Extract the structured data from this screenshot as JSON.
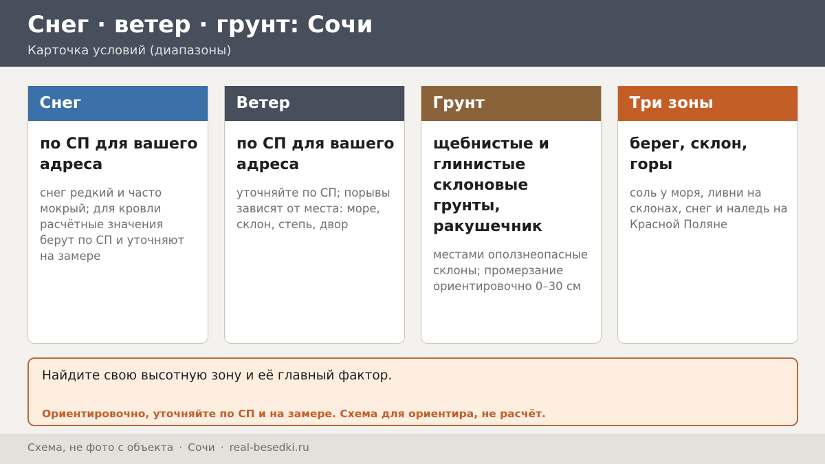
{
  "header": {
    "title": "Снег · ветер · грунт: Сочи",
    "subtitle": "Карточка условий (диапазоны)"
  },
  "cards": [
    {
      "label": "Снег",
      "color": "#3b71a8",
      "main": "по СП для вашего адреса",
      "note": "снег редкий и часто мокрый; для кровли расчётные значения берут по СП и уточняют на замере"
    },
    {
      "label": "Ветер",
      "color": "#464f5b",
      "main": "по СП для вашего адреса",
      "note": "уточняйте по СП; порывы зависят от места: море, склон, степь, двор"
    },
    {
      "label": "Грунт",
      "color": "#8b633b",
      "main": "щебнистые и глинистые склоновые грунты, ракушечник",
      "note": "местами оползнеопасные склоны; промерзание ориентировочно 0–30 см"
    },
    {
      "label": "Три зоны",
      "color": "#c45e27",
      "main": "берег, склон, горы",
      "note": "соль у моря, ливни на склонах, снег и наледь на Красной Поляне"
    }
  ],
  "callout": {
    "main": "Найдите свою высотную зону и её главный фактор.",
    "note": "Ориентировочно, уточняйте по СП и на замере. Схема для ориентира, не расчёт."
  },
  "footer": {
    "source": "Схема, не фото с объекта",
    "separator": "·",
    "city": "Сочи",
    "site": "real-besedki.ru"
  }
}
